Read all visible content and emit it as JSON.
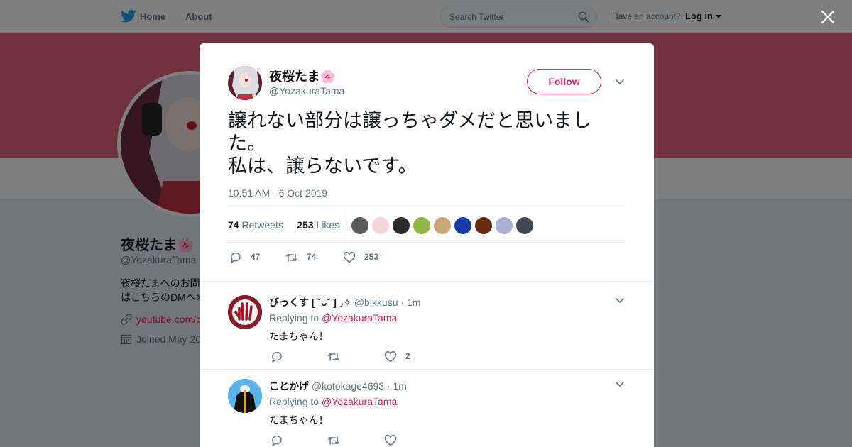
{
  "nav": {
    "home": "Home",
    "about": "About",
    "search_placeholder": "Search Twitter",
    "have_account": "Have an account?",
    "login": "Log in"
  },
  "profile": {
    "name": "夜桜たま🌸",
    "handle": "@YozakuraTama",
    "bio_line1": "夜桜たまへのお問",
    "bio_line2": "はこちらのDMへ※",
    "link": "youtube.com/c",
    "joined": "Joined May 20",
    "banner_color": "#e06080"
  },
  "tweet": {
    "author_name": "夜桜たま🌸",
    "author_handle": "@YozakuraTama",
    "follow_label": "Follow",
    "text": "譲れない部分は譲っちゃダメだと思いました。\n私は、譲らないです。",
    "timestamp": "10:51 AM - 6 Oct 2019",
    "retweets": "74",
    "retweets_label": "Retweets",
    "likes": "253",
    "likes_label": "Likes",
    "reply_count": "47",
    "retweet_count": "74",
    "like_count": "253",
    "liker_avatar_colors": [
      "#5a5a5a",
      "#f2d6d6",
      "#2a2a2a",
      "#8fb840",
      "#c8a878",
      "#1a3aa8",
      "#6a2a10",
      "#a8b0d0",
      "#404850"
    ]
  },
  "replies": [
    {
      "name": "びっくす [ ˘ᴗ˘ ] ◞✧",
      "handle": "@bikkusu",
      "time": "· 1m",
      "replying_label": "Replying to",
      "replying_to": "@YozakuraTama",
      "text": "たまちゃん！",
      "like_count": "2",
      "avatar_color": "#8a1a2a"
    },
    {
      "name": "ことかげ",
      "handle": "@kotokage4693",
      "time": "· 1m",
      "replying_label": "Replying to",
      "replying_to": "@YozakuraTama",
      "text": "たまちゃん！",
      "like_count": "",
      "avatar_color": "#4aa8e8"
    }
  ],
  "colors": {
    "accent": "#e0245e",
    "twitter_blue": "#1da1f2",
    "muted": "#657786"
  }
}
